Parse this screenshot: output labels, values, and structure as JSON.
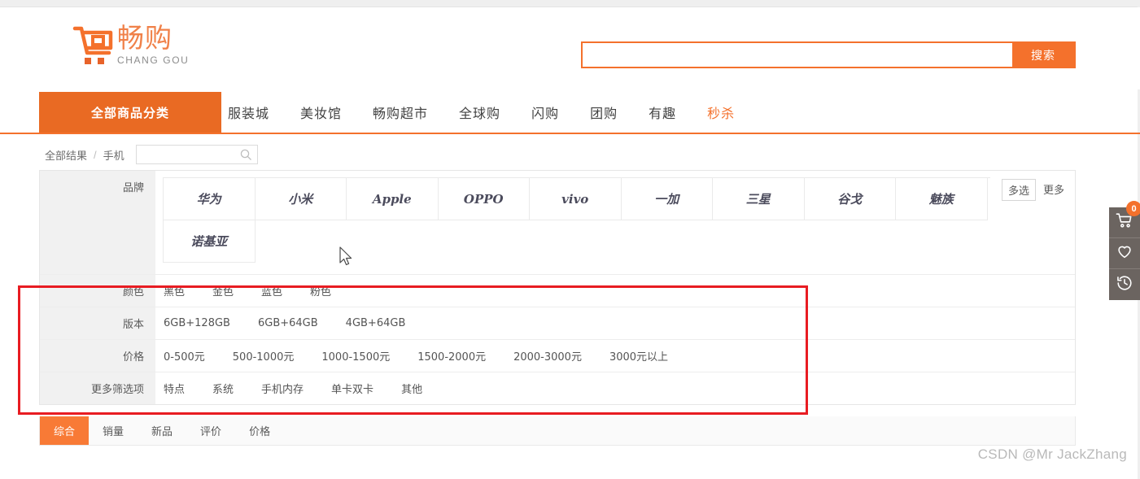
{
  "brand": {
    "logo_cn": "畅购",
    "logo_en": "CHANG GOU",
    "accent_color": "#f4712c",
    "nav_active_color": "#e96a23",
    "annotation_color": "#e81c22"
  },
  "search": {
    "value": "",
    "placeholder": "",
    "button_label": "搜索",
    "icon": "search-icon"
  },
  "nav": {
    "all_categories": "全部商品分类",
    "items": [
      {
        "label": "服装城",
        "accent": false
      },
      {
        "label": "美妆馆",
        "accent": false
      },
      {
        "label": "畅购超市",
        "accent": false
      },
      {
        "label": "全球购",
        "accent": false
      },
      {
        "label": "闪购",
        "accent": false
      },
      {
        "label": "团购",
        "accent": false
      },
      {
        "label": "有趣",
        "accent": false
      },
      {
        "label": "秒杀",
        "accent": true
      }
    ]
  },
  "breadcrumb": {
    "all_results": "全部结果",
    "separator": "/",
    "current": "手机",
    "search_value": "",
    "search_placeholder": "",
    "search_icon": "search-icon"
  },
  "filters": {
    "brand": {
      "label": "品牌",
      "options": [
        "华为",
        "小米",
        "Apple",
        "OPPO",
        "vivo",
        "一加",
        "三星",
        "谷戈",
        "魅族",
        "诺基亚"
      ],
      "multi_select_label": "多选",
      "more_label": "更多"
    },
    "rows": [
      {
        "label": "颜色",
        "options": [
          "黑色",
          "金色",
          "蓝色",
          "粉色"
        ]
      },
      {
        "label": "版本",
        "options": [
          "6GB+128GB",
          "6GB+64GB",
          "4GB+64GB"
        ]
      },
      {
        "label": "价格",
        "options": [
          "0-500元",
          "500-1000元",
          "1000-1500元",
          "1500-2000元",
          "2000-3000元",
          "3000元以上"
        ]
      },
      {
        "label": "更多筛选项",
        "options": [
          "特点",
          "系统",
          "手机内存",
          "单卡双卡",
          "其他"
        ]
      }
    ]
  },
  "sort": {
    "tabs": [
      {
        "label": "综合",
        "active": true
      },
      {
        "label": "销量",
        "active": false
      },
      {
        "label": "新品",
        "active": false
      },
      {
        "label": "评价",
        "active": false
      },
      {
        "label": "价格",
        "active": false
      }
    ]
  },
  "right_sidebar": {
    "items": [
      {
        "icon": "cart-icon",
        "badge": "0"
      },
      {
        "icon": "heart-icon",
        "badge": ""
      },
      {
        "icon": "history-icon",
        "badge": ""
      }
    ]
  },
  "watermark": {
    "text": "CSDN @Mr JackZhang"
  }
}
